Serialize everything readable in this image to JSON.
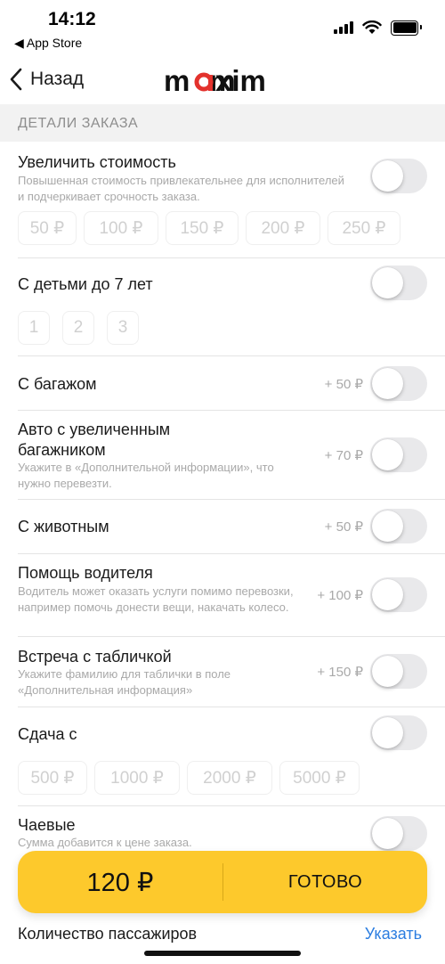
{
  "status_bar": {
    "time": "14:12",
    "back_app": "◀ App Store",
    "icons": [
      "signal-icon",
      "wifi-icon",
      "battery-icon"
    ]
  },
  "nav": {
    "back_label": "Назад",
    "logo_text": "maxim",
    "logo_color": "#e3322d"
  },
  "section": {
    "title": "ДЕТАЛИ ЗАКАЗА"
  },
  "options": {
    "increase_price": {
      "title": "Увеличить стоимость",
      "description": "Повышенная стоимость привлекательнее для исполнителей и подчеркивает срочность заказа.",
      "enabled": false,
      "chips": [
        "50 ₽",
        "100 ₽",
        "150 ₽",
        "200 ₽",
        "250 ₽"
      ]
    },
    "with_children": {
      "title": "С детьми до 7 лет",
      "enabled": false,
      "chips": [
        "1",
        "2",
        "3"
      ]
    },
    "luggage": {
      "title": "С багажом",
      "price": "+ 50 ₽",
      "enabled": false
    },
    "big_trunk": {
      "title_line1": "Авто с увеличенным",
      "title_line2": "багажником",
      "description": "Укажите в «Дополнительной информации», что нужно перевезти.",
      "price": "+ 70 ₽",
      "enabled": false
    },
    "pet": {
      "title": "С животным",
      "price": "+ 50 ₽",
      "enabled": false
    },
    "driver_help": {
      "title": "Помощь водителя",
      "description": "Водитель может оказать услуги помимо перевозки, например помочь донести вещи, накачать колесо.",
      "price": "+ 100 ₽",
      "enabled": false
    },
    "sign_meeting": {
      "title": "Встреча с табличкой",
      "description": "Укажите фамилию для таблички в поле «Дополнительная информация»",
      "price": "+ 150 ₽",
      "enabled": false
    },
    "change_from": {
      "title": "Сдача с",
      "enabled": false,
      "chips": [
        "500 ₽",
        "1000 ₽",
        "2000 ₽",
        "5000 ₽"
      ]
    },
    "tips": {
      "title": "Чаевые",
      "description": "Сумма добавится к цене заказа.",
      "enabled": false
    }
  },
  "bottom_bar": {
    "total": "120 ₽",
    "done_label": "ГОТОВО",
    "color": "#fdc92c"
  },
  "passengers": {
    "label": "Количество пассажиров",
    "action": "Указать",
    "action_color": "#2b7de0"
  }
}
